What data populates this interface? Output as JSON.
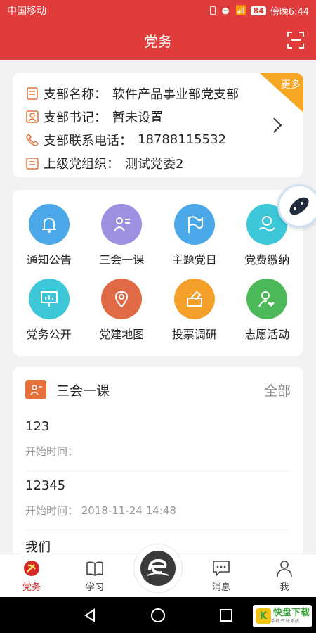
{
  "status_bar": {
    "carrier": "中国移动",
    "battery": "84",
    "time": "傍晚6:44"
  },
  "header": {
    "title": "党务"
  },
  "branch": {
    "name_label": "支部名称：",
    "name_value": "软件产品事业部党支部",
    "secretary_label": "支部书记：",
    "secretary_value": "暂未设置",
    "phone_label": "支部联系电话：",
    "phone_value": "18788115532",
    "parent_label": "上级党组织：",
    "parent_value": "测试党委2",
    "more_label": "更多"
  },
  "menu": {
    "items": [
      {
        "label": "通知公告",
        "color": "#4aa8e8",
        "icon": "bell-icon"
      },
      {
        "label": "三会一课",
        "color": "#9e8fe0",
        "icon": "meeting-icon"
      },
      {
        "label": "主题党日",
        "color": "#4aa8e8",
        "icon": "flag-icon"
      },
      {
        "label": "党费缴纳",
        "color": "#3cc8d8",
        "icon": "payment-icon"
      },
      {
        "label": "党务公开",
        "color": "#3cc8d8",
        "icon": "presentation-icon"
      },
      {
        "label": "党建地图",
        "color": "#e06a45",
        "icon": "map-icon"
      },
      {
        "label": "投票调研",
        "color": "#f5a02a",
        "icon": "vote-icon"
      },
      {
        "label": "志愿活动",
        "color": "#4cb85a",
        "icon": "volunteer-icon"
      }
    ]
  },
  "meetings": {
    "title": "三会一课",
    "all_label": "全部",
    "items": [
      {
        "name": "123",
        "time": "开始时间："
      },
      {
        "name": "12345",
        "time": "开始时间：  2018-11-24 14:48"
      },
      {
        "name": "我们",
        "time": ""
      }
    ]
  },
  "tabbar": {
    "tabs": [
      {
        "label": "党务"
      },
      {
        "label": "学习"
      },
      {
        "label": "消息"
      },
      {
        "label": "我"
      }
    ]
  },
  "watermark": {
    "text": "快盘下载",
    "char": "K",
    "sub": "手机·开发·系统"
  },
  "colors": {
    "brand_red": "#e03c3c",
    "ribbon_orange": "#f5a623"
  }
}
